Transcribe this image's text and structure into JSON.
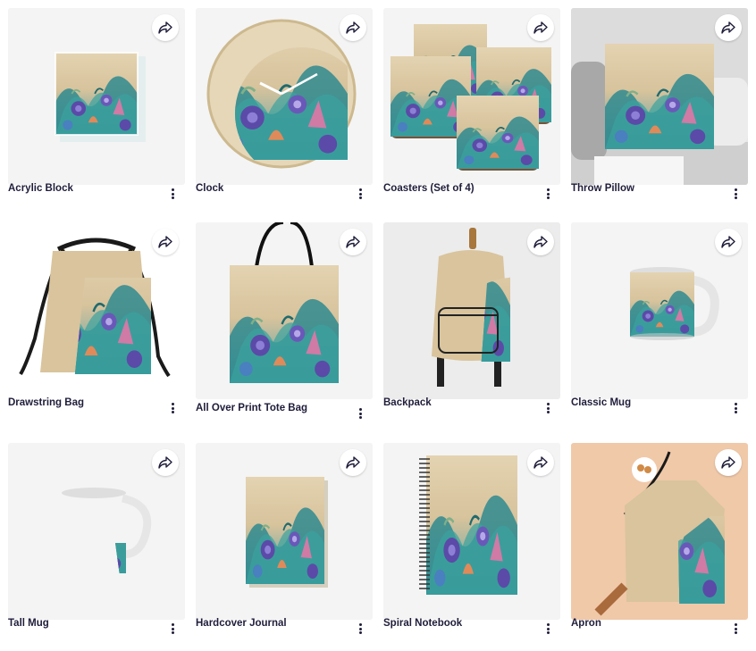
{
  "colors": {
    "title_text": "#1f1d3a",
    "card_bg": "#f3f3f3",
    "wood": "#dcc9a4",
    "teal": "#3d97a0",
    "purple": "#5b4aa8",
    "orchid_pink": "#d07aa6"
  },
  "products": [
    {
      "title": "Acrylic Block",
      "share_icon": "share-arrow-icon",
      "menu_icon": "more-vertical-icon"
    },
    {
      "title": "Clock",
      "share_icon": "share-arrow-icon",
      "menu_icon": "more-vertical-icon"
    },
    {
      "title": "Coasters (Set of 4)",
      "share_icon": "share-arrow-icon",
      "menu_icon": "more-vertical-icon"
    },
    {
      "title": "Throw Pillow",
      "share_icon": "share-arrow-icon",
      "menu_icon": "more-vertical-icon"
    },
    {
      "title": "Drawstring Bag",
      "share_icon": "share-arrow-icon",
      "menu_icon": "more-vertical-icon"
    },
    {
      "title": "All Over Print Tote Bag",
      "share_icon": "share-arrow-icon",
      "menu_icon": "more-vertical-icon"
    },
    {
      "title": "Backpack",
      "share_icon": "share-arrow-icon",
      "menu_icon": "more-vertical-icon"
    },
    {
      "title": "Classic Mug",
      "share_icon": "share-arrow-icon",
      "menu_icon": "more-vertical-icon"
    },
    {
      "title": "Tall Mug",
      "share_icon": "share-arrow-icon",
      "menu_icon": "more-vertical-icon"
    },
    {
      "title": "Hardcover Journal",
      "share_icon": "share-arrow-icon",
      "menu_icon": "more-vertical-icon"
    },
    {
      "title": "Spiral Notebook",
      "share_icon": "share-arrow-icon",
      "menu_icon": "more-vertical-icon"
    },
    {
      "title": "Apron",
      "share_icon": "share-arrow-icon",
      "menu_icon": "more-vertical-icon"
    }
  ]
}
